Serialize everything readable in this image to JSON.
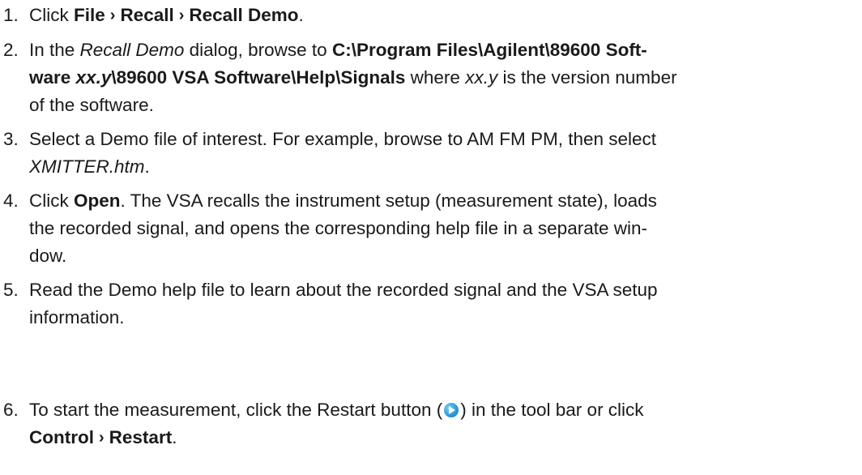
{
  "steps": [
    {
      "number": "1.",
      "t1": "Click ",
      "b1": "File",
      "sep1": "›",
      "b2": "Recall",
      "sep2": "›",
      "b3": "Recall Demo",
      "t2": "."
    },
    {
      "number": "2.",
      "l1_t1": "In the ",
      "l1_i1": "Recall Demo",
      "l1_t2": " dialog, browse to ",
      "l1_b1": "C:\\Program Files\\Agilent\\89600 Soft-",
      "l2_b1": "ware ",
      "l2_bi1": "xx.y",
      "l2_b2": "\\89600 VSA Software\\Help\\Signals",
      "l2_t1": " where ",
      "l2_i1": "xx.y",
      "l2_t2": " is the version number",
      "l3_t1": "of the software."
    },
    {
      "number": "3.",
      "l1_t1": "Select a Demo file of interest. For example, browse to AM FM PM, then select",
      "l2_i1": "XMITTER.htm",
      "l2_t1": "."
    },
    {
      "number": "4.",
      "l1_t1": "Click ",
      "l1_b1": "Open",
      "l1_t2": ". The VSA recalls the instrument setup (measurement state), loads",
      "l2_t1": "the recorded signal, and opens the corresponding help file in a separate win-",
      "l3_t1": "dow."
    },
    {
      "number": "5.",
      "l1_t1": "Read the Demo help file to learn about the recorded signal and the VSA setup",
      "l2_t1": "information."
    },
    {
      "number": "6.",
      "l1_t1": "To start the measurement, click the Restart button (",
      "l1_icon": "play-icon",
      "l1_t2": ") in the tool bar or click",
      "l2_b1": "Control",
      "l2_sep": "›",
      "l2_b2": "Restart",
      "l2_t1": "."
    }
  ]
}
